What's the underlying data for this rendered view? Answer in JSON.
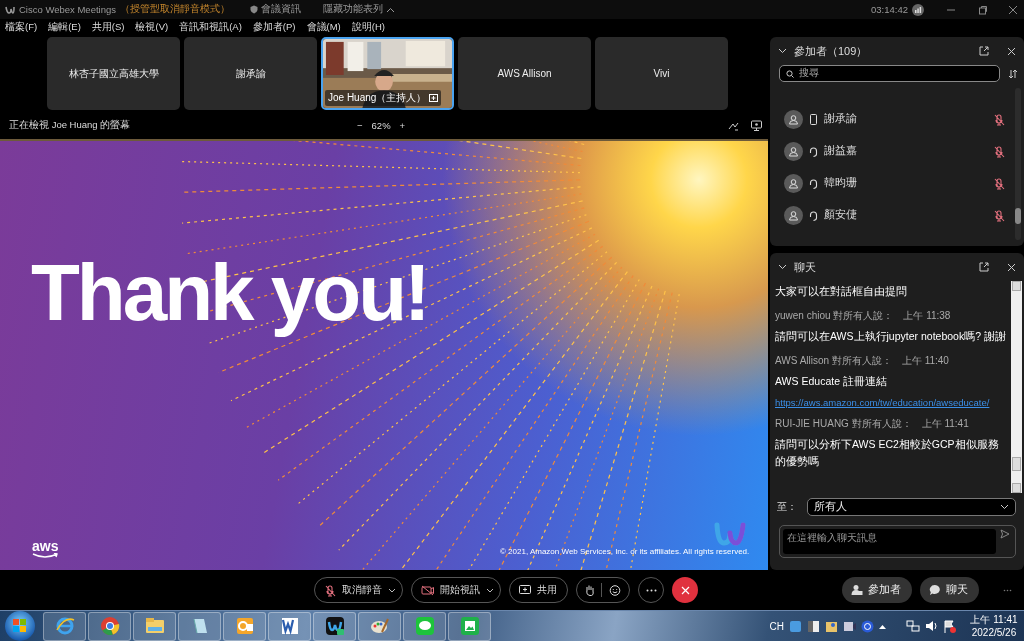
{
  "title_bar": {
    "app": "Cisco Webex Meetings",
    "mode": "（授管型取消靜音模式）",
    "meeting_info": "會議資訊",
    "hide_menu": "隱藏功能表列",
    "clock": "03:14:42"
  },
  "menu": [
    "檔案(F)",
    "編輯(E)",
    "共用(S)",
    "檢視(V)",
    "音訊和視訊(A)",
    "參加者(P)",
    "會議(M)",
    "說明(H)"
  ],
  "video_tiles": [
    {
      "name": "林杏子國立高雄大學",
      "kind": "name",
      "selected": false
    },
    {
      "name": "謝承諭",
      "kind": "name",
      "selected": false
    },
    {
      "name": "Joe Huang（主持人）",
      "kind": "video",
      "selected": true
    },
    {
      "name": "AWS Allison",
      "kind": "name",
      "selected": false
    },
    {
      "name": "Vivi",
      "kind": "name",
      "selected": false
    }
  ],
  "viewing": {
    "label": "正在檢視 Joe Huang 的螢幕",
    "zoom_out": "−",
    "zoom": "62%",
    "zoom_in": "+"
  },
  "slide": {
    "heading": "Thank you!",
    "logo": "aws",
    "copyright": "© 2021, Amazon Web Services, Inc. or its affiliates. All rights reserved."
  },
  "participants": {
    "title": "參加者（109）",
    "search_placeholder": "搜尋",
    "items": [
      {
        "name": "謝承諭",
        "kind": "mobile",
        "muted": true
      },
      {
        "name": "謝益嘉",
        "kind": "headset",
        "muted": true
      },
      {
        "name": "韓昀珊",
        "kind": "headset",
        "muted": true
      },
      {
        "name": "顏安倢",
        "kind": "headset",
        "muted": true
      }
    ]
  },
  "chat": {
    "title": "聊天",
    "messages": [
      {
        "lines": [
          {
            "kind": "text",
            "text": "大家可以在對話框自由提問"
          }
        ]
      },
      {
        "sender": "yuwen chiou",
        "to": "對所有人說：",
        "time": "上午 11:38",
        "lines": [
          {
            "kind": "text",
            "text": "請問可以在AWS上執行jupyter notebook嗎? 謝謝"
          }
        ]
      },
      {
        "sender": "AWS Allison",
        "to": "對所有人說：",
        "time": "上午 11:40",
        "lines": [
          {
            "kind": "text",
            "text": "AWS Educate 註冊連結"
          },
          {
            "kind": "link",
            "text": "https://aws.amazon.com/tw/education/awseducate/"
          }
        ]
      },
      {
        "sender": "RUI-JIE HUANG",
        "to": "對所有人說：",
        "time": "上午 11:41",
        "lines": [
          {
            "kind": "text",
            "text": "請問可以分析下AWS EC2相較於GCP相似服務的優勢嗎"
          }
        ]
      }
    ],
    "to_label": "至：",
    "to_value": "所有人",
    "input_placeholder": "在這裡輸入聊天訊息"
  },
  "controls": [
    {
      "kind": "mute",
      "label": "取消靜音"
    },
    {
      "kind": "video",
      "label": "開始視訊"
    },
    {
      "kind": "share",
      "label": "共用"
    },
    {
      "kind": "reactions"
    },
    {
      "kind": "more"
    },
    {
      "kind": "leave"
    }
  ],
  "side_controls": [
    {
      "kind": "participants",
      "label": "參加者"
    },
    {
      "kind": "chat",
      "label": "聊天"
    }
  ],
  "taskbar": {
    "ime": "CH",
    "time": "上午 11:41",
    "date": "2022/5/26"
  }
}
